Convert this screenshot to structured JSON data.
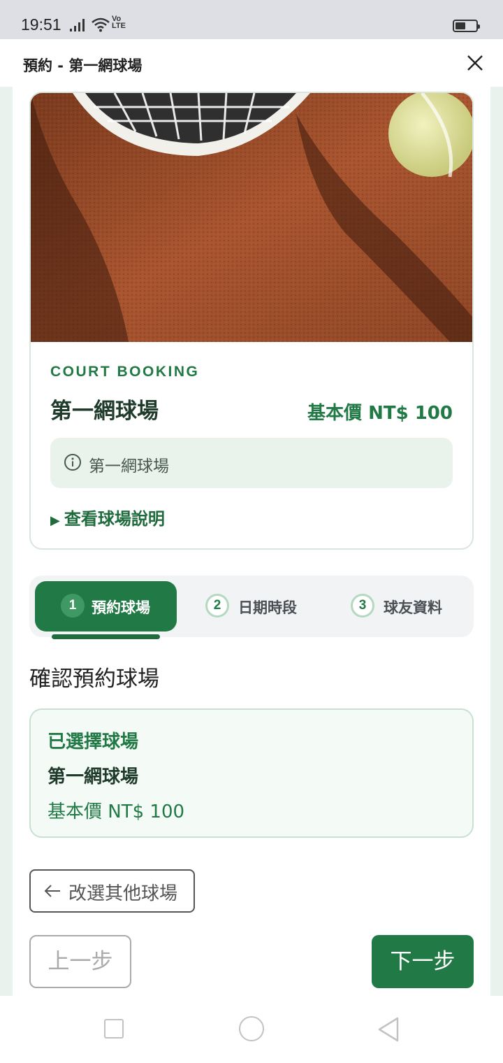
{
  "status_bar": {
    "time": "19:51",
    "volte_line1": "Vo",
    "volte_line2": "LTE",
    "battery_level": 0.5
  },
  "header": {
    "title": "預約 - 第一網球場",
    "close_icon": "close-icon"
  },
  "court_card": {
    "eyebrow": "COURT BOOKING",
    "name": "第一網球場",
    "base_price": "基本價 NT$ 100",
    "info_icon": "info-icon",
    "info_text": "第一網球場",
    "details_toggle": "查看球場說明",
    "details_toggle_icon": "▶"
  },
  "stepper": {
    "steps": [
      {
        "number": "1",
        "label": "預約球場",
        "active": true
      },
      {
        "number": "2",
        "label": "日期時段",
        "active": false
      },
      {
        "number": "3",
        "label": "球友資料",
        "active": false
      }
    ]
  },
  "section": {
    "title": "確認預約球場"
  },
  "selected_court": {
    "heading": "已選擇球場",
    "name": "第一網球場",
    "price": "基本價 NT$ 100"
  },
  "actions": {
    "change_court": "改選其他球場",
    "change_court_icon": "arrow-left-icon",
    "prev": "上一步",
    "next": "下一步"
  },
  "colors": {
    "primary": "#217a45",
    "primary_dark": "#1f6b3d",
    "tint": "#e9f3ec"
  }
}
